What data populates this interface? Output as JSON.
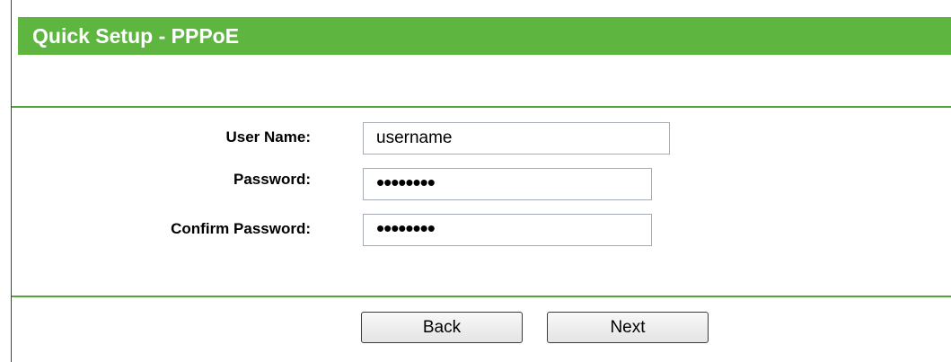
{
  "header": {
    "title": "Quick Setup - PPPoE"
  },
  "form": {
    "username_label": "User Name:",
    "username_value": "username",
    "password_label": "Password:",
    "password_value": "••••••••",
    "confirm_label": "Confirm Password:",
    "confirm_value": "••••••••"
  },
  "buttons": {
    "back_label": "Back",
    "next_label": "Next"
  },
  "colors": {
    "title_bar": "#5eb641",
    "divider": "#52a637"
  }
}
